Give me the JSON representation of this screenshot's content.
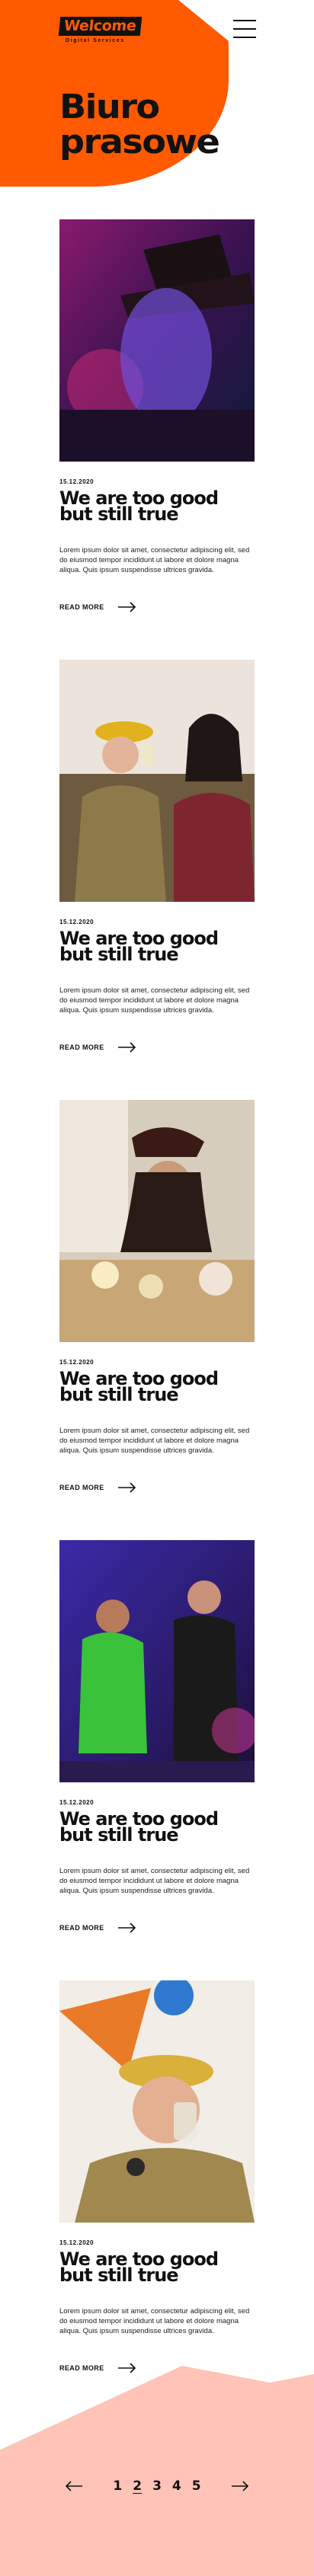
{
  "header": {
    "logo_text": "Welcome",
    "logo_sub": "Digital Services",
    "menu_icon": "hamburger-icon"
  },
  "page": {
    "title_line1": "Biuro",
    "title_line2": "prasowe"
  },
  "posts": [
    {
      "date": "15.12.2020",
      "title": "We are too good but still true",
      "excerpt": "Lorem ipsum dolor sit amet, consectetur adipiscing elit, sed do eiusmod tempor incididunt ut labore et dolore magna aliqua. Quis ipsum suspendisse ultrices gravida.",
      "read_more": "READ MORE",
      "photo": "party-photo-hat"
    },
    {
      "date": "15.12.2020",
      "title": "We are too good but still true",
      "excerpt": "Lorem ipsum dolor sit amet, consectetur adipiscing elit, sed do eiusmod tempor incididunt ut labore et dolore magna aliqua. Quis ipsum suspendisse ultrices gravida.",
      "read_more": "READ MORE",
      "photo": "party-photo-drinks"
    },
    {
      "date": "15.12.2020",
      "title": "We are too good but still true",
      "excerpt": "Lorem ipsum dolor sit amet, consectetur adipiscing elit, sed do eiusmod tempor incididunt ut labore et dolore magna aliqua. Quis ipsum suspendisse ultrices gravida.",
      "read_more": "READ MORE",
      "photo": "party-photo-pirate"
    },
    {
      "date": "15.12.2020",
      "title": "We are too good but still true",
      "excerpt": "Lorem ipsum dolor sit amet, consectetur adipiscing elit, sed do eiusmod tempor incididunt ut labore et dolore magna aliqua. Quis ipsum suspendisse ultrices gravida.",
      "read_more": "READ MORE",
      "photo": "party-photo-dance"
    },
    {
      "date": "15.12.2020",
      "title": "We are too good but still true",
      "excerpt": "Lorem ipsum dolor sit amet, consectetur adipiscing elit, sed do eiusmod tempor incididunt ut labore et dolore magna aliqua. Quis ipsum suspendisse ultrices gravida.",
      "read_more": "READ MORE",
      "photo": "party-photo-toast"
    }
  ],
  "pagination": {
    "pages": [
      "1",
      "2",
      "3",
      "4",
      "5"
    ],
    "active": "2",
    "prev_icon": "arrow-left-icon",
    "next_icon": "arrow-right-icon"
  },
  "colors": {
    "accent": "#ff5a00",
    "footer_blob": "#ffc3b7",
    "text": "#111111"
  }
}
